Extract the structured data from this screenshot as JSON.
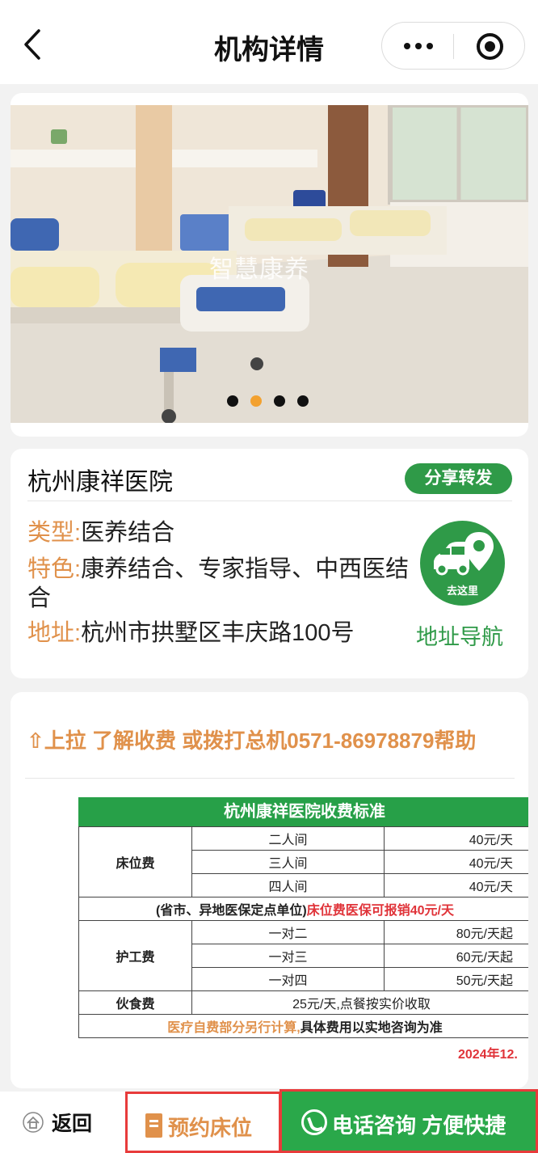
{
  "nav": {
    "title": "机构详情"
  },
  "carousel": {
    "watermark": "智慧康养",
    "slide_count": 4,
    "active_index": 1
  },
  "institution": {
    "name": "杭州康祥医院",
    "share_label": "分享转发",
    "type_label": "类型:",
    "type_value": "医养结合",
    "feature_label": "特色:",
    "feature_value": "康养结合、专家指导、中西医结合",
    "address_label": "地址:",
    "address_value": "杭州市拱墅区丰庆路100号",
    "goto_label": "去这里",
    "nav_link": "地址导航"
  },
  "fees": {
    "hint": "⇧上拉 了解收费 或拨打总机0571-86978879帮助",
    "table_title": "杭州康祥医院收费标准",
    "bed_label": "床位费",
    "bed_rows": [
      {
        "room": "二人间",
        "price": "40元/天"
      },
      {
        "room": "三人间",
        "price": "40元/天"
      },
      {
        "room": "四人间",
        "price": "40元/天"
      }
    ],
    "insurance_note_a": "(省市、异地医保定点单位)",
    "insurance_note_b": "床位费医保可报销40元/天",
    "care_label": "护工费",
    "care_rows": [
      {
        "ratio": "一对二",
        "price": "80元/天起"
      },
      {
        "ratio": "一对三",
        "price": "60元/天起"
      },
      {
        "ratio": "一对四",
        "price": "50元/天起"
      }
    ],
    "meal_label": "伙食费",
    "meal_value": "25元/天,点餐按实价收取",
    "selfpay_note_a": "医疗自费部分另行计算,",
    "selfpay_note_b": "具体费用以实地咨询为准",
    "date": "2024年12,"
  },
  "bottom_bar": {
    "return_label": "返回",
    "book_label": "预约床位",
    "call_label": "电话咨询 方便快捷"
  },
  "colors": {
    "brand_green": "#2f9a48",
    "accent_orange": "#e0914b",
    "alert_red": "#e0343a"
  }
}
